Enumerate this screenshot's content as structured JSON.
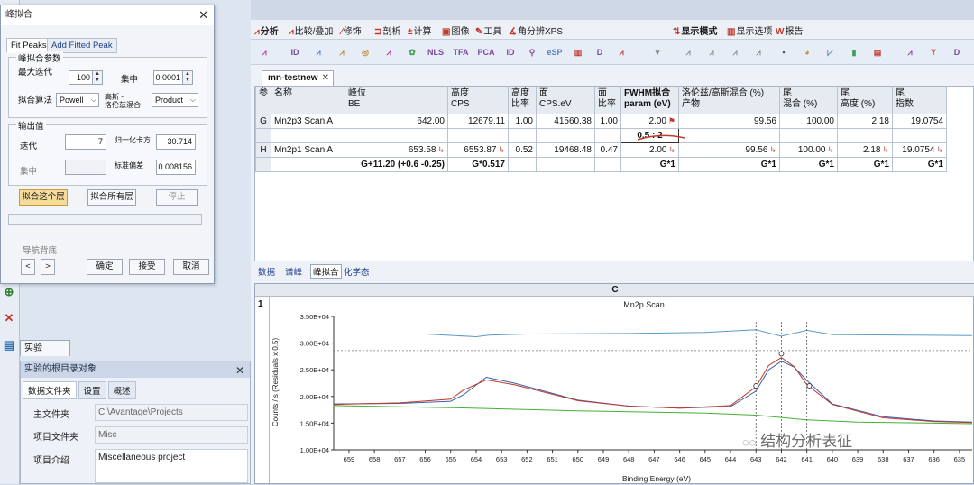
{
  "dialog": {
    "title": "峰拟合",
    "tabs": [
      "Fit Peaks",
      "Add Fitted Peak"
    ],
    "params_group": "峰拟合参数",
    "max_iter_label": "最大迭代",
    "max_iter_value": "100",
    "convergence_label": "集中",
    "convergence_value": "0.0001",
    "algorithm_label": "拟合算法",
    "algorithm_value": "Powell",
    "mix_label_1": "高斯 -",
    "mix_label_2": "洛伦兹混合",
    "mix_value": "Product",
    "output_group": "输出值",
    "iter_label": "迭代",
    "iter_value": "7",
    "norm_chi_label": "归一化卡方",
    "norm_chi_value": "30.714",
    "conv_out_label": "集中",
    "conv_out_value": "",
    "std_dev_label": "标准偏差",
    "std_dev_value": "0.008156",
    "fit_layer_btn": "拟合这个层",
    "fit_all_btn": "拟合所有层",
    "stop_btn": "停止",
    "nav_bg_label": "导航背底",
    "ok_btn": "确定",
    "accept_btn": "接受",
    "cancel_btn": "取消"
  },
  "experiment_panel": {
    "tab_label": "实验",
    "title": "实验的根目录对象",
    "tabs": [
      "数据文件夹",
      "设置",
      "概述"
    ],
    "fields": [
      {
        "label": "主文件夹",
        "value": "C:\\Avantage\\Projects"
      },
      {
        "label": "项目文件夹",
        "value": "Misc"
      },
      {
        "label": "项目介绍",
        "value": "Miscellaneous project"
      }
    ]
  },
  "menu": [
    {
      "icon": "⩘",
      "label": "分析"
    },
    {
      "icon": "⩘",
      "label": "比较/叠加"
    },
    {
      "icon": "∕",
      "label": "修饰"
    },
    {
      "icon": "⊐",
      "label": "剖析"
    },
    {
      "icon": "±",
      "label": "计算"
    },
    {
      "icon": "▣",
      "label": "图像"
    },
    {
      "icon": "✎",
      "label": "工具"
    },
    {
      "icon": "∡",
      "label": "角分辨XPS"
    },
    {
      "icon": "⇅",
      "label": "显示模式"
    },
    {
      "icon": "▥",
      "label": "显示选项"
    },
    {
      "icon": "W",
      "label": "报告"
    }
  ],
  "toolbar_icons": [
    "ID",
    "NLS",
    "TFA",
    "PCA",
    "ID",
    "eSP",
    "D"
  ],
  "document_tab": "mn-testnew",
  "table": {
    "headers": [
      [
        "参",
        ""
      ],
      [
        "名称",
        ""
      ],
      [
        "峰位",
        "BE"
      ],
      [
        "高度",
        "CPS"
      ],
      [
        "高度",
        "比率"
      ],
      [
        "面",
        "CPS.eV"
      ],
      [
        "面",
        "比率"
      ],
      [
        "FWHM拟合",
        "param (eV)"
      ],
      [
        "洛伦兹/高斯混合 (%)",
        "产物"
      ],
      [
        "尾",
        "混合 (%)"
      ],
      [
        "尾",
        "高度 (%)"
      ],
      [
        "尾",
        "指数"
      ]
    ],
    "rows": [
      {
        "id": "G",
        "name": "Mn2p3 Scan A",
        "be": "642.00",
        "height": "12679.11",
        "hratio": "1.00",
        "area": "41560.38",
        "aratio": "1.00",
        "fwhm": "2.00",
        "lg": "99.56",
        "tmix": "100.00",
        "theight": "2.18",
        "texp": "19.0754"
      },
      {
        "id": "",
        "name": "",
        "be": "",
        "height": "",
        "hratio": "",
        "area": "",
        "aratio": "",
        "fwhm": "0.5 : 2",
        "lg": "",
        "tmix": "",
        "theight": "",
        "texp": ""
      },
      {
        "id": "H",
        "name": "Mn2p1 Scan A",
        "be": "653.58",
        "height": "6553.87",
        "hratio": "0.52",
        "area": "19468.48",
        "aratio": "0.47",
        "fwhm": "2.00",
        "lg": "99.56",
        "tmix": "100.00",
        "theight": "2.18",
        "texp": "19.0754"
      },
      {
        "id": "",
        "name": "",
        "be": "G+11.20 (+0.6 -0.25)",
        "height": "G*0.517",
        "hratio": "",
        "area": "",
        "aratio": "",
        "fwhm": "G*1",
        "lg": "G*1",
        "tmix": "G*1",
        "theight": "G*1",
        "texp": "G*1"
      }
    ]
  },
  "bottom_tabs": [
    "数据",
    "谱峰",
    "峰拟合",
    "化学态"
  ],
  "plot_header": "C",
  "plot_rownum": "1",
  "watermark": "结构分析表征",
  "chart_data": {
    "type": "line",
    "title": "Mn2p Scan",
    "xlabel": "Binding Energy (eV)",
    "ylabel": "Counts / s  (Residuals x 0.5)",
    "x_ticks": [
      659,
      658,
      657,
      656,
      655,
      654,
      653,
      652,
      651,
      650,
      649,
      648,
      647,
      646,
      645,
      644,
      643,
      642,
      641,
      640,
      639,
      638,
      637,
      636,
      635
    ],
    "y_ticks": [
      "1.00E+04",
      "1.50E+04",
      "2.00E+04",
      "2.50E+04",
      "3.00E+04",
      "3.50E+04"
    ],
    "xlim": [
      659.6,
      634.5
    ],
    "ylim": [
      10000,
      35000
    ],
    "x_reversed": true,
    "series": [
      {
        "color": "#3a5fb0",
        "x": [
          659.6,
          657,
          655,
          654.5,
          653.6,
          652.5,
          650,
          648,
          646,
          644,
          643,
          642.5,
          642,
          641.5,
          641,
          640,
          638,
          636,
          634.5
        ],
        "y": [
          18600,
          18700,
          19100,
          20300,
          23600,
          22500,
          19300,
          18200,
          17800,
          18100,
          21000,
          25000,
          26600,
          25500,
          23000,
          18600,
          16200,
          15400,
          15200
        ]
      },
      {
        "color": "#c0392b",
        "x": [
          659.6,
          657,
          655,
          654.5,
          653.6,
          652.5,
          650,
          648,
          646,
          644,
          643,
          642.5,
          642,
          641.5,
          641,
          640,
          638,
          636,
          634.5
        ],
        "y": [
          18500,
          18800,
          19500,
          21200,
          23100,
          22200,
          19200,
          18200,
          17800,
          18300,
          21800,
          25800,
          27300,
          25600,
          22200,
          18500,
          16000,
          15300,
          15100
        ]
      },
      {
        "color": "#45b035",
        "x": [
          659.6,
          655,
          650,
          645,
          643,
          641,
          639,
          636,
          634.5
        ],
        "y": [
          18300,
          17900,
          17300,
          16900,
          16500,
          15600,
          15200,
          15000,
          14900
        ]
      },
      {
        "color": "#5b9bc0",
        "x": [
          659.6,
          656,
          654,
          653.5,
          652,
          648,
          645,
          643,
          642,
          641,
          640,
          637,
          634.5
        ],
        "y": [
          31700,
          31700,
          31200,
          31500,
          31700,
          31800,
          32000,
          32500,
          31300,
          32400,
          31600,
          31500,
          31400
        ]
      }
    ]
  }
}
